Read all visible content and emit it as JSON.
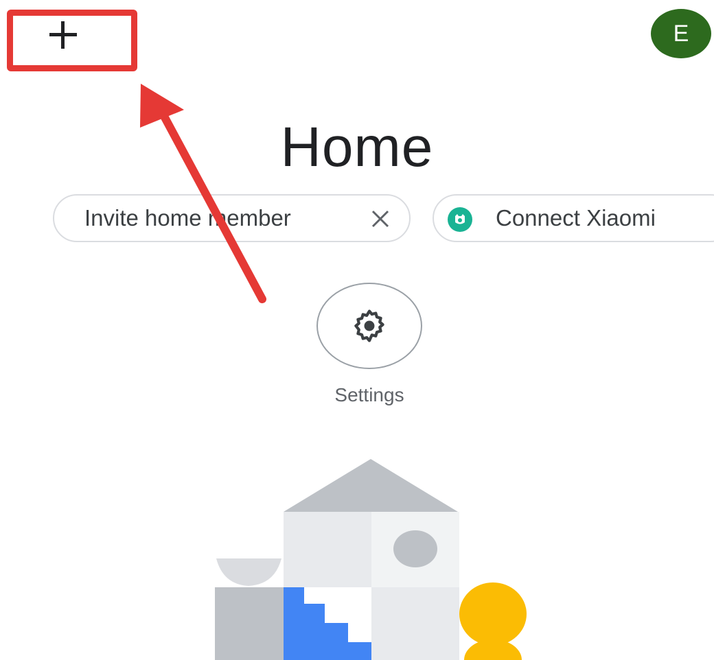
{
  "header": {
    "add_icon": "plus-icon",
    "avatar_letter": "E",
    "avatar_color": "#2d6a1e"
  },
  "page": {
    "title": "Home"
  },
  "chips": {
    "invite_label": "Invite home member",
    "invite_close_icon": "close-icon",
    "xiaomi_label": "Connect Xiaomi",
    "xiaomi_icon": "xiaomi-icon",
    "xiaomi_color": "#1ab394"
  },
  "settings": {
    "icon": "gear-icon",
    "label": "Settings"
  },
  "annotation": {
    "highlight_color": "#e53935"
  }
}
